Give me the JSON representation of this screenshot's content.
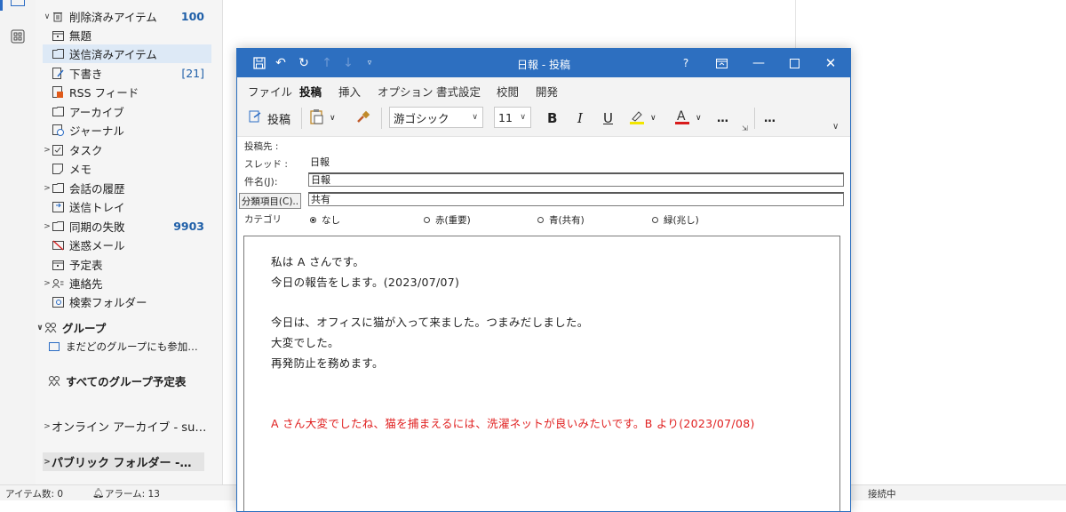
{
  "folders": {
    "items": [
      {
        "label": "削除済みアイテム",
        "count": "100",
        "chev": "∨",
        "icon": "trash-icon"
      },
      {
        "label": "無題",
        "icon": "calendar-icon"
      },
      {
        "label": "送信済みアイテム",
        "icon": "sent-folder-icon",
        "selected": true
      },
      {
        "label": "下書き",
        "count": "[21]",
        "icon": "draft-icon"
      },
      {
        "label": "RSS フィード",
        "icon": "rss-icon"
      },
      {
        "label": "アーカイブ",
        "icon": "archive-icon"
      },
      {
        "label": "ジャーナル",
        "icon": "journal-icon"
      },
      {
        "label": "タスク",
        "chev": ">",
        "icon": "task-icon"
      },
      {
        "label": "メモ",
        "icon": "note-icon"
      },
      {
        "label": "会話の履歴",
        "chev": ">",
        "icon": "folder-icon"
      },
      {
        "label": "送信トレイ",
        "icon": "outbox-icon"
      },
      {
        "label": "同期の失敗",
        "count": "9903",
        "chev": ">",
        "icon": "folder-icon"
      },
      {
        "label": "迷惑メール",
        "icon": "junk-icon"
      },
      {
        "label": "予定表",
        "icon": "calendar-icon"
      },
      {
        "label": "連絡先",
        "chev": ">",
        "icon": "contacts-icon"
      },
      {
        "label": "検索フォルダー",
        "icon": "search-folder-icon"
      }
    ],
    "groups_label": "グループ",
    "group_item": "まだどのグループにも参加…",
    "all_groups_calendar": "すべてのグループ予定表",
    "online_archive": "オンライン アーカイブ - su…",
    "public_folders": "パブリック フォルダー -…"
  },
  "status": {
    "items": "アイテム数: 0",
    "alarms": "アラーム: 13",
    "connection": "接続中"
  },
  "window": {
    "title": "日報 - 投稿",
    "help": "?",
    "tabs": [
      "ファイル",
      "投稿",
      "挿入",
      "オプション",
      "書式設定",
      "校閲",
      "開発"
    ],
    "post_button": "投稿",
    "font_name": "游ゴシック",
    "font_size": "11",
    "bold": "B",
    "italic": "I",
    "underline": "U",
    "more": "…"
  },
  "fields": {
    "post_to_label": "投稿先 :",
    "thread_label": "スレッド :",
    "thread_value": "日報",
    "subject_label": "件名(J):",
    "subject_value": "日報",
    "category_button": "分類項目(C)..",
    "category_value": "共有",
    "category_label": "カテゴリ",
    "radios": [
      "なし",
      "赤(重要)",
      "青(共有)",
      "緑(兆し)"
    ]
  },
  "body": {
    "lines": [
      "私は A さんです。",
      "今日の報告をします。(2023/07/07)",
      "今日は、オフィスに猫が入って来ました。つまみだしました。",
      "大変でした。",
      "再発防止を務めます。"
    ],
    "reply": "A さん大変でしたね、猫を捕まえるには、洗濯ネットが良いみたいです。B より(2023/07/08)"
  }
}
